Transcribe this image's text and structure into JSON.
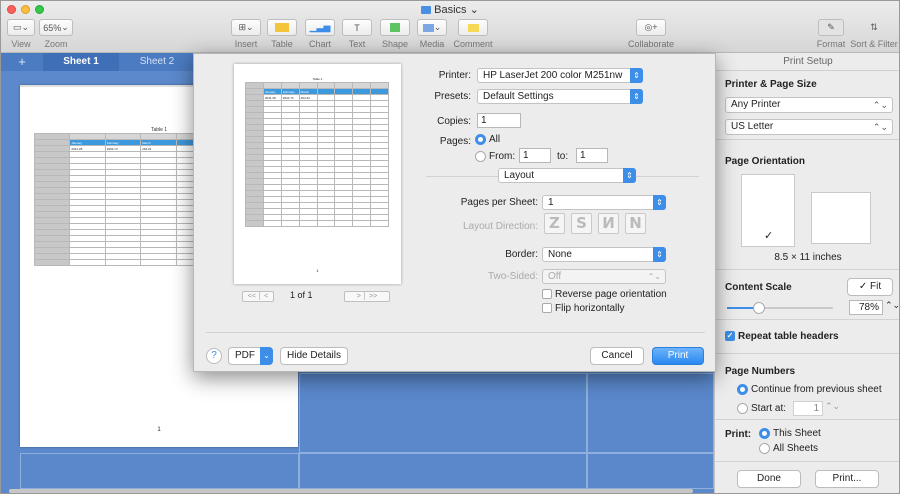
{
  "window": {
    "title": "Basics"
  },
  "toolbar": {
    "items": [
      {
        "label": "View",
        "icon": "sidebar-icon"
      },
      {
        "label": "Zoom",
        "value": "65%"
      },
      {
        "label": "Insert",
        "icon": "insert-icon"
      },
      {
        "label": "Table",
        "icon": "table-icon"
      },
      {
        "label": "Chart",
        "icon": "chart-icon"
      },
      {
        "label": "Text",
        "icon": "text-icon"
      },
      {
        "label": "Shape",
        "icon": "shape-icon"
      },
      {
        "label": "Media",
        "icon": "media-icon"
      },
      {
        "label": "Comment",
        "icon": "comment-icon"
      },
      {
        "label": "Collaborate",
        "icon": "collaborate-icon"
      },
      {
        "label": "Format",
        "icon": "format-brush-icon"
      },
      {
        "label": "Sort & Filter",
        "icon": "sort-filter-icon"
      }
    ]
  },
  "sheets": {
    "add": "+",
    "tabs": [
      "Sheet 1",
      "Sheet 2"
    ]
  },
  "page_preview": {
    "table_title": "Table 1",
    "headers": [
      "January",
      "February",
      "March"
    ],
    "values": [
      "2041.28",
      "2004.73",
      "264.22"
    ],
    "page_number": "1"
  },
  "dialog": {
    "printer_label": "Printer:",
    "printer_value": "HP LaserJet 200 color M251nw",
    "presets_label": "Presets:",
    "presets_value": "Default Settings",
    "copies_label": "Copies:",
    "copies_value": "1",
    "pages_label": "Pages:",
    "all_label": "All",
    "from_label": "From:",
    "from_value": "1",
    "to_label": "to:",
    "to_value": "1",
    "section_value": "Layout",
    "pps_label": "Pages per Sheet:",
    "pps_value": "1",
    "layout_dir_label": "Layout Direction:",
    "border_label": "Border:",
    "border_value": "None",
    "two_sided_label": "Two-Sided:",
    "two_sided_value": "Off",
    "reverse_label": "Reverse page orientation",
    "flip_label": "Flip horizontally",
    "preview_page_indicator": "1 of 1",
    "preview_number": "1",
    "help": "?",
    "pdf": "PDF",
    "hide_details": "Hide Details",
    "cancel": "Cancel",
    "print": "Print"
  },
  "sidebar": {
    "header": "Print Setup",
    "printer_page_size_title": "Printer & Page Size",
    "printer_select": "Any Printer",
    "paper_select": "US Letter",
    "orientation_title": "Page Orientation",
    "paper_size_label": "8.5 × 11 inches",
    "content_scale_title": "Content Scale",
    "fit_label": "✓ Fit",
    "scale_value": "78%",
    "scale_fraction": 0.3,
    "repeat_headers_label": "Repeat table headers",
    "page_numbers_title": "Page Numbers",
    "continue_label": "Continue from previous sheet",
    "start_at_label": "Start at:",
    "start_at_value": "1",
    "print_label": "Print:",
    "this_sheet_label": "This Sheet",
    "all_sheets_label": "All Sheets",
    "done": "Done",
    "print_button": "Print..."
  },
  "colors": {
    "accent": "#3d8ee9",
    "canvas": "#5c89cb",
    "tab_bar": "#4b7bc1"
  }
}
